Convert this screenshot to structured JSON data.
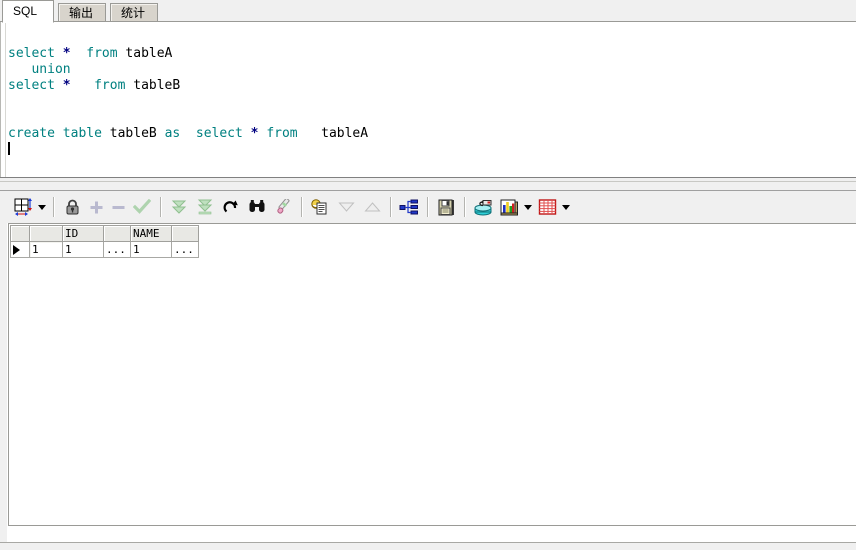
{
  "window": {
    "title": "SQL Worksheet",
    "background": "#f0f0f0"
  },
  "tabs": [
    {
      "id": "sql",
      "label": "SQL",
      "active": true,
      "cjk": false
    },
    {
      "id": "output",
      "label": "输出",
      "active": false,
      "cjk": true
    },
    {
      "id": "stats",
      "label": "统计",
      "active": false,
      "cjk": true
    }
  ],
  "editor": {
    "name": "sql-editor",
    "colors": {
      "keyword": "#008080",
      "operator": "#000080",
      "identifier": "#000000",
      "background": "#ffffff"
    },
    "lines": [
      {
        "n": 1,
        "tokens": [
          {
            "t": "select",
            "k": "kw"
          },
          {
            "t": " ",
            "k": "sp"
          },
          {
            "t": "*",
            "k": "star"
          },
          {
            "t": "  ",
            "k": "sp"
          },
          {
            "t": "from",
            "k": "kw"
          },
          {
            "t": " ",
            "k": "sp"
          },
          {
            "t": "tableA",
            "k": "ident"
          }
        ]
      },
      {
        "n": 2,
        "tokens": [
          {
            "t": "   ",
            "k": "sp"
          },
          {
            "t": "union",
            "k": "kw"
          }
        ]
      },
      {
        "n": 3,
        "tokens": [
          {
            "t": "select",
            "k": "kw"
          },
          {
            "t": " ",
            "k": "sp"
          },
          {
            "t": "*",
            "k": "star"
          },
          {
            "t": "   ",
            "k": "sp"
          },
          {
            "t": "from",
            "k": "kw"
          },
          {
            "t": " ",
            "k": "sp"
          },
          {
            "t": "tableB",
            "k": "ident"
          }
        ]
      },
      {
        "n": 4,
        "tokens": []
      },
      {
        "n": 5,
        "tokens": []
      },
      {
        "n": 6,
        "tokens": [
          {
            "t": "create",
            "k": "kw"
          },
          {
            "t": " ",
            "k": "sp"
          },
          {
            "t": "table",
            "k": "kw"
          },
          {
            "t": " ",
            "k": "sp"
          },
          {
            "t": "tableB",
            "k": "ident"
          },
          {
            "t": " ",
            "k": "sp"
          },
          {
            "t": "as",
            "k": "kw"
          },
          {
            "t": "  ",
            "k": "sp"
          },
          {
            "t": "select",
            "k": "kw"
          },
          {
            "t": " ",
            "k": "sp"
          },
          {
            "t": "*",
            "k": "star"
          },
          {
            "t": " ",
            "k": "sp"
          },
          {
            "t": "from",
            "k": "kw"
          },
          {
            "t": "   ",
            "k": "sp"
          },
          {
            "t": "tableA",
            "k": "ident"
          }
        ]
      },
      {
        "n": 7,
        "tokens": [],
        "caret": true
      }
    ],
    "plain_text": "select *  from tableA\n   union\nselect *   from tableB\n\n\ncreate table tableB as  select * from   tableA\n"
  },
  "toolbar": {
    "items": [
      {
        "id": "grid-layout",
        "icon": "grid-layout-icon",
        "label": "Single record / grid view",
        "enabled": true,
        "dropdown": true
      },
      {
        "sep": true
      },
      {
        "id": "lock",
        "icon": "lock-icon",
        "label": "Lock record",
        "enabled": true
      },
      {
        "id": "insert",
        "icon": "plus-icon",
        "label": "Insert record",
        "enabled": false
      },
      {
        "id": "delete",
        "icon": "minus-icon",
        "label": "Delete record",
        "enabled": false
      },
      {
        "id": "post",
        "icon": "checkmark-icon",
        "label": "Post changes",
        "enabled": false
      },
      {
        "sep": true
      },
      {
        "id": "fetch-next",
        "icon": "double-down-arrow-icon",
        "label": "Fetch next rows",
        "enabled": false
      },
      {
        "id": "fetch-all",
        "icon": "double-down-bar-icon",
        "label": "Fetch all rows",
        "enabled": false
      },
      {
        "id": "refresh",
        "icon": "refresh-icon",
        "label": "Refresh",
        "enabled": true
      },
      {
        "id": "find",
        "icon": "binoculars-icon",
        "label": "Find",
        "enabled": true
      },
      {
        "id": "clear-filter",
        "icon": "brush-icon",
        "label": "Clear filter",
        "enabled": true
      },
      {
        "sep": true
      },
      {
        "id": "copy-data",
        "icon": "copy-data-icon",
        "label": "Copy data",
        "enabled": true
      },
      {
        "id": "sort-desc",
        "icon": "triangle-down-icon",
        "label": "Sort descending",
        "enabled": false
      },
      {
        "id": "sort-asc",
        "icon": "triangle-up-icon",
        "label": "Sort ascending",
        "enabled": false
      },
      {
        "sep": true
      },
      {
        "id": "dependencies",
        "icon": "tree-hierarchy-icon",
        "label": "Dependencies",
        "enabled": true
      },
      {
        "sep": true
      },
      {
        "id": "save",
        "icon": "floppy-save-icon",
        "label": "Save",
        "enabled": true
      },
      {
        "sep": true
      },
      {
        "id": "export-db",
        "icon": "database-export-icon",
        "label": "Export to database",
        "enabled": true
      },
      {
        "id": "chart",
        "icon": "bar-chart-icon",
        "label": "Chart",
        "enabled": true,
        "dropdown": true
      },
      {
        "id": "table-view",
        "icon": "red-table-icon",
        "label": "Table view",
        "enabled": true,
        "dropdown": true
      }
    ]
  },
  "results": {
    "name": "result-grid",
    "columns": [
      {
        "id": "marker",
        "label": ""
      },
      {
        "id": "rownum",
        "label": ""
      },
      {
        "id": "ID",
        "label": "ID"
      },
      {
        "id": "id_ell",
        "label": ""
      },
      {
        "id": "NAME",
        "label": "NAME"
      },
      {
        "id": "nm_ell",
        "label": ""
      }
    ],
    "rows": [
      {
        "selected": true,
        "marker": "▶",
        "rownum": "1",
        "ID": "1",
        "id_ell": "...",
        "NAME": "1",
        "nm_ell": "..."
      }
    ],
    "row_count": 1
  }
}
